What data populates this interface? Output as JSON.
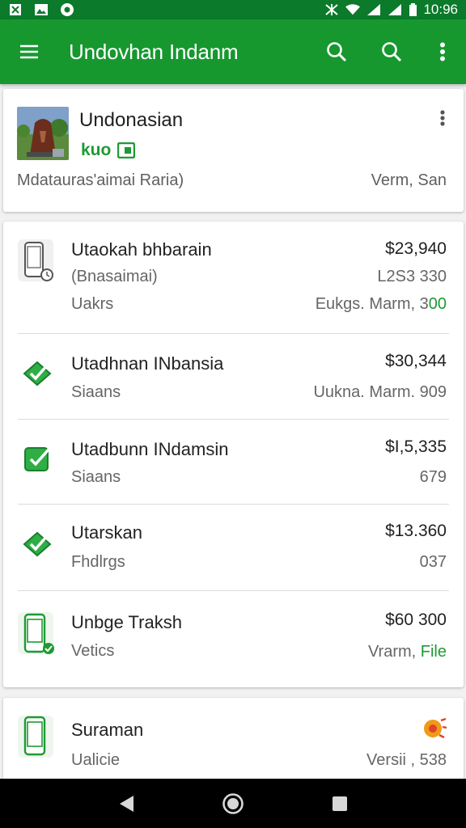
{
  "status_bar": {
    "time": "10:96"
  },
  "toolbar": {
    "title": "Undovhan Indanm"
  },
  "header_card": {
    "title": "Undonasian",
    "subtitle": "kuo",
    "meta_left": "Mdatauras'aimai Raria)",
    "meta_right": "Verm, San"
  },
  "transactions": [
    {
      "icon": "phone-icon",
      "title": "Utaokah bhbarain",
      "subtitle": "(Bnasaimai)",
      "extra": "Uakrs",
      "amount": "$23,940",
      "meta": "L2S3 330",
      "meta2_prefix": "Eukgs. Marm, 3",
      "meta2_accent": "00"
    },
    {
      "icon": "check-diamond-icon",
      "title": "Utadhnan INbansia",
      "subtitle": "Siaans",
      "amount": "$30,344",
      "meta": "Uukna. Marm. 909"
    },
    {
      "icon": "check-square-icon",
      "title": "Utadbunn INdamsin",
      "subtitle": "Siaans",
      "amount": "$I,5,335",
      "meta": "679"
    },
    {
      "icon": "check-diamond-icon",
      "title": "Utarskan",
      "subtitle": "Fhdlrgs",
      "amount": "$13.360",
      "meta": "037"
    },
    {
      "icon": "phone-check-icon",
      "title": "Unbge Traksh",
      "subtitle": "Vetics",
      "amount": "$60 300",
      "meta_prefix": "Vrarm, ",
      "meta_accent": "File"
    }
  ],
  "bottom_card": {
    "title": "Suraman",
    "subtitle": "Ualicie",
    "meta": "Versii , 538"
  },
  "colors": {
    "primary": "#16982f",
    "primary_dark": "#0b7a2a",
    "accent": "#1e9a33",
    "badge": "#f09a1a"
  }
}
